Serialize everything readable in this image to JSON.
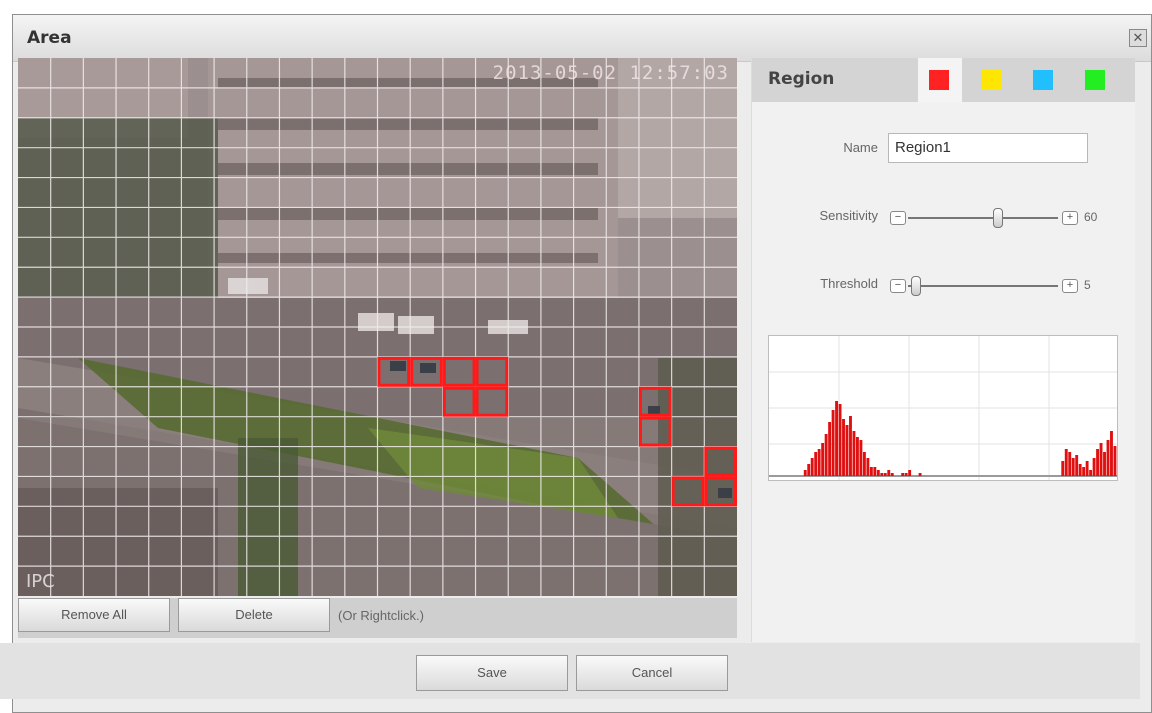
{
  "dialog": {
    "title": "Area"
  },
  "video": {
    "timestamp": "2013-05-02 12:57:03",
    "channel_label": "IPC",
    "grid_cols": 22,
    "grid_rows": 18,
    "selected_cells": [
      [
        11,
        10
      ],
      [
        12,
        10
      ],
      [
        13,
        10
      ],
      [
        14,
        10
      ],
      [
        13,
        11
      ],
      [
        14,
        11
      ],
      [
        19,
        11
      ],
      [
        19,
        12
      ],
      [
        21,
        13
      ],
      [
        20,
        14
      ],
      [
        21,
        14
      ]
    ]
  },
  "buttons": {
    "remove_all": "Remove All",
    "delete": "Delete",
    "hint": "(Or Rightclick.)",
    "save": "Save",
    "cancel": "Cancel"
  },
  "region": {
    "title": "Region",
    "tab_colors": [
      "#ff2222",
      "#ffe600",
      "#22bfff",
      "#22ee22"
    ],
    "active_tab": 0,
    "name_label": "Name",
    "name_value": "Region1",
    "sensitivity_label": "Sensitivity",
    "sensitivity_value": "60",
    "sensitivity_level": 0.6,
    "threshold_label": "Threshold",
    "threshold_value": "5",
    "threshold_level": 0.05,
    "graph_bars": [
      0,
      0,
      0,
      0,
      0,
      0,
      0,
      0,
      0,
      0,
      2,
      4,
      6,
      8,
      9,
      11,
      14,
      18,
      22,
      25,
      24,
      19,
      17,
      20,
      15,
      13,
      12,
      8,
      6,
      3,
      3,
      2,
      1,
      1,
      2,
      1,
      0,
      0,
      1,
      1,
      2,
      0,
      0,
      1,
      0,
      0,
      0,
      0,
      0,
      0,
      0,
      0,
      0,
      0,
      0,
      0,
      0,
      0,
      0,
      0,
      0,
      0,
      0,
      0,
      0,
      0,
      0,
      0,
      0,
      0,
      0,
      0,
      0,
      0,
      0,
      0,
      0,
      0,
      0,
      0,
      0,
      0,
      0,
      0,
      5,
      9,
      8,
      6,
      7,
      4,
      3,
      5,
      2,
      6,
      9,
      11,
      8,
      12,
      15,
      10
    ]
  }
}
